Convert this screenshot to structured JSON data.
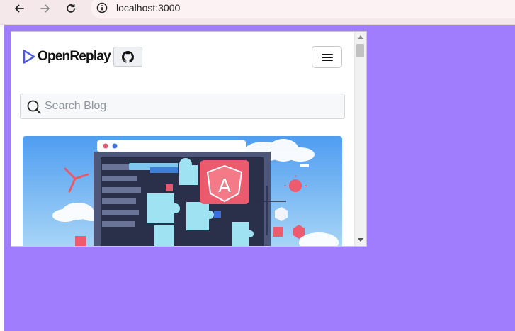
{
  "browser": {
    "url": "localhost:3000",
    "back_icon": "arrow-left-icon",
    "forward_icon": "arrow-right-icon",
    "reload_icon": "reload-icon",
    "site_info_icon": "info-icon"
  },
  "header": {
    "logo_text": "OpenReplay",
    "github_icon": "github-icon",
    "menu_icon": "hamburger-icon"
  },
  "search": {
    "placeholder": "Search Blog",
    "value": ""
  },
  "hero": {
    "image_label": "A",
    "image_icon": "angular-puzzle-illustration"
  },
  "colors": {
    "page_background": "#a07dfd",
    "browser_bar": "#f4e8ea",
    "logo_accent": "#4a59e8"
  }
}
